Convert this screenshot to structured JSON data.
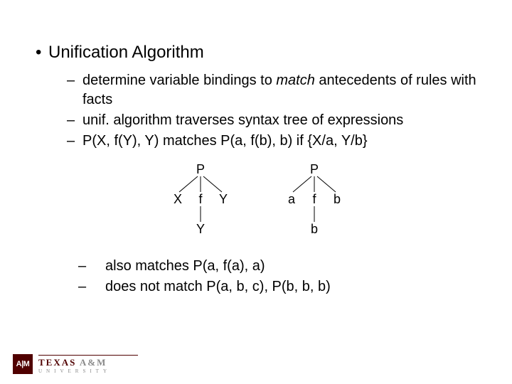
{
  "main_bullet": "Unification Algorithm",
  "subs": {
    "s1a": "determine variable bindings to ",
    "s1b": "match",
    "s1c": " antecedents of rules with facts",
    "s2": "unif. algorithm traverses syntax tree of expressions",
    "s3": "P(X, f(Y), Y) matches P(a, f(b), b) if {X/a, Y/b}"
  },
  "tree": {
    "left": {
      "root": "P",
      "c1": "X",
      "c2": "f",
      "c3": "Y",
      "leaf": "Y"
    },
    "right": {
      "root": "P",
      "c1": "a",
      "c2": "f",
      "c3": "b",
      "leaf": "b"
    }
  },
  "subs2": {
    "a": "also matches P(a, f(a), a)",
    "b": "does not match P(a, b, c), P(b, b, b)"
  },
  "logo": {
    "mark": "A|M",
    "line1a": "TEXAS ",
    "line1amp": "A&M",
    "line2": "UNIVERSITY"
  }
}
